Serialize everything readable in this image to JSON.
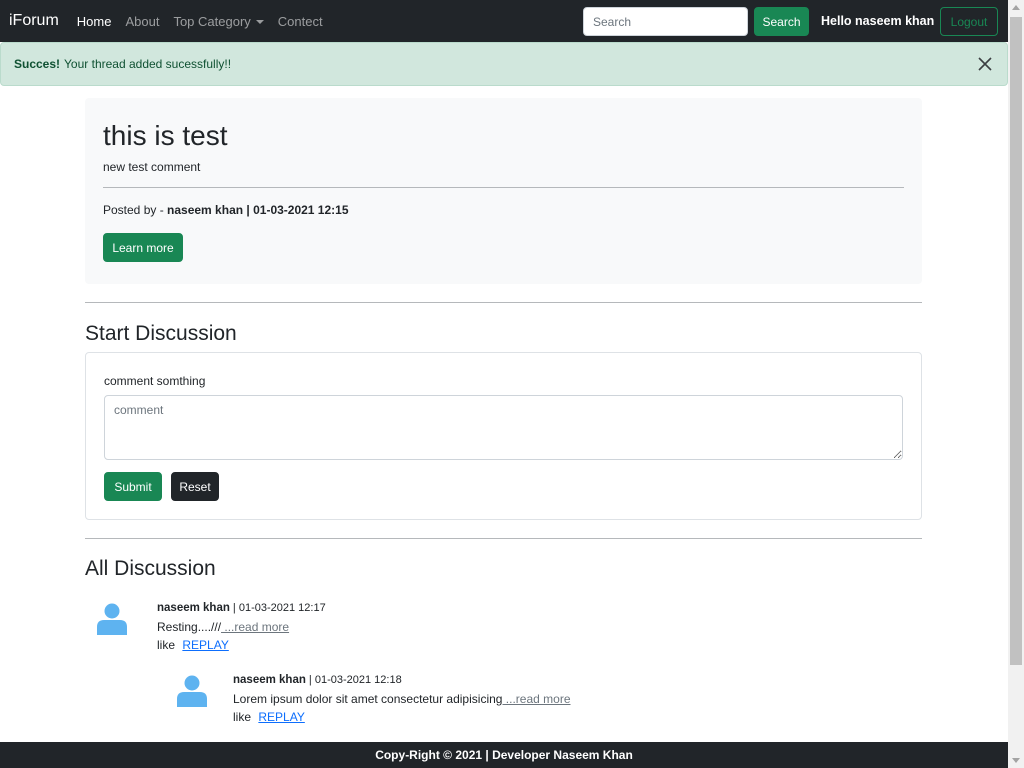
{
  "navbar": {
    "brand": "iForum",
    "links": [
      "Home",
      "About",
      "Top Category",
      "Contect"
    ],
    "search_placeholder": "Search",
    "search_button": "Search",
    "greeting": "Hello naseem khan",
    "logout_label": "Logout"
  },
  "alert": {
    "strong": "Succes!",
    "message": "Your thread added sucessfully!!"
  },
  "thread": {
    "title": "this is test",
    "description": "new test comment",
    "posted_prefix": "Posted by - ",
    "posted_meta": "naseem khan | 01-03-2021 12:15",
    "learn_more": "Learn more"
  },
  "discussion_form": {
    "heading": "Start Discussion",
    "label": "comment somthing",
    "placeholder": "comment",
    "submit_label": "Submit",
    "reset_label": "Reset"
  },
  "all_discussion": {
    "heading": "All Discussion",
    "comments": [
      {
        "author": "naseem khan",
        "datetime": " | 01-03-2021 12:17",
        "text": "Resting....///",
        "read_more": " ...read more",
        "like": "like",
        "reply": "REPLAY"
      },
      {
        "author": "naseem khan",
        "datetime": " | 01-03-2021 12:18",
        "text": "Lorem ipsum dolor sit amet consectetur adipisicing",
        "read_more": " ...read more",
        "like": "like",
        "reply": "REPLAY"
      }
    ]
  },
  "footer": {
    "text": "Copy-Right © 2021 | Developer Naseem Khan"
  },
  "colors": {
    "navbar_bg": "#212529",
    "success": "#198754",
    "alert_bg": "#d1e7dd",
    "avatar": "#5eb3f0",
    "link": "#0d6efd"
  }
}
